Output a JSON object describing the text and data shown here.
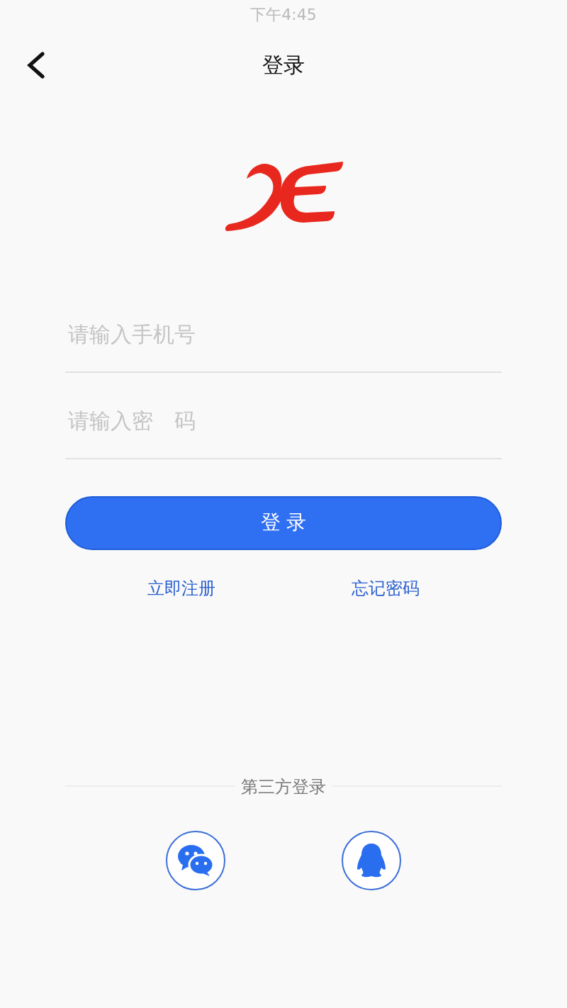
{
  "status_bar": {
    "time": "下午4:45"
  },
  "nav": {
    "title": "登录"
  },
  "form": {
    "fields": [
      {
        "placeholder": "请输入手机号"
      },
      {
        "placeholder": "请输入密　码"
      }
    ],
    "submit": "登 录",
    "links": [
      "立即注册",
      "忘记密码"
    ]
  },
  "third_party": {
    "title": "第三方登录",
    "options": [
      {
        "kind": "wechat"
      },
      {
        "kind": "qq"
      }
    ]
  }
}
